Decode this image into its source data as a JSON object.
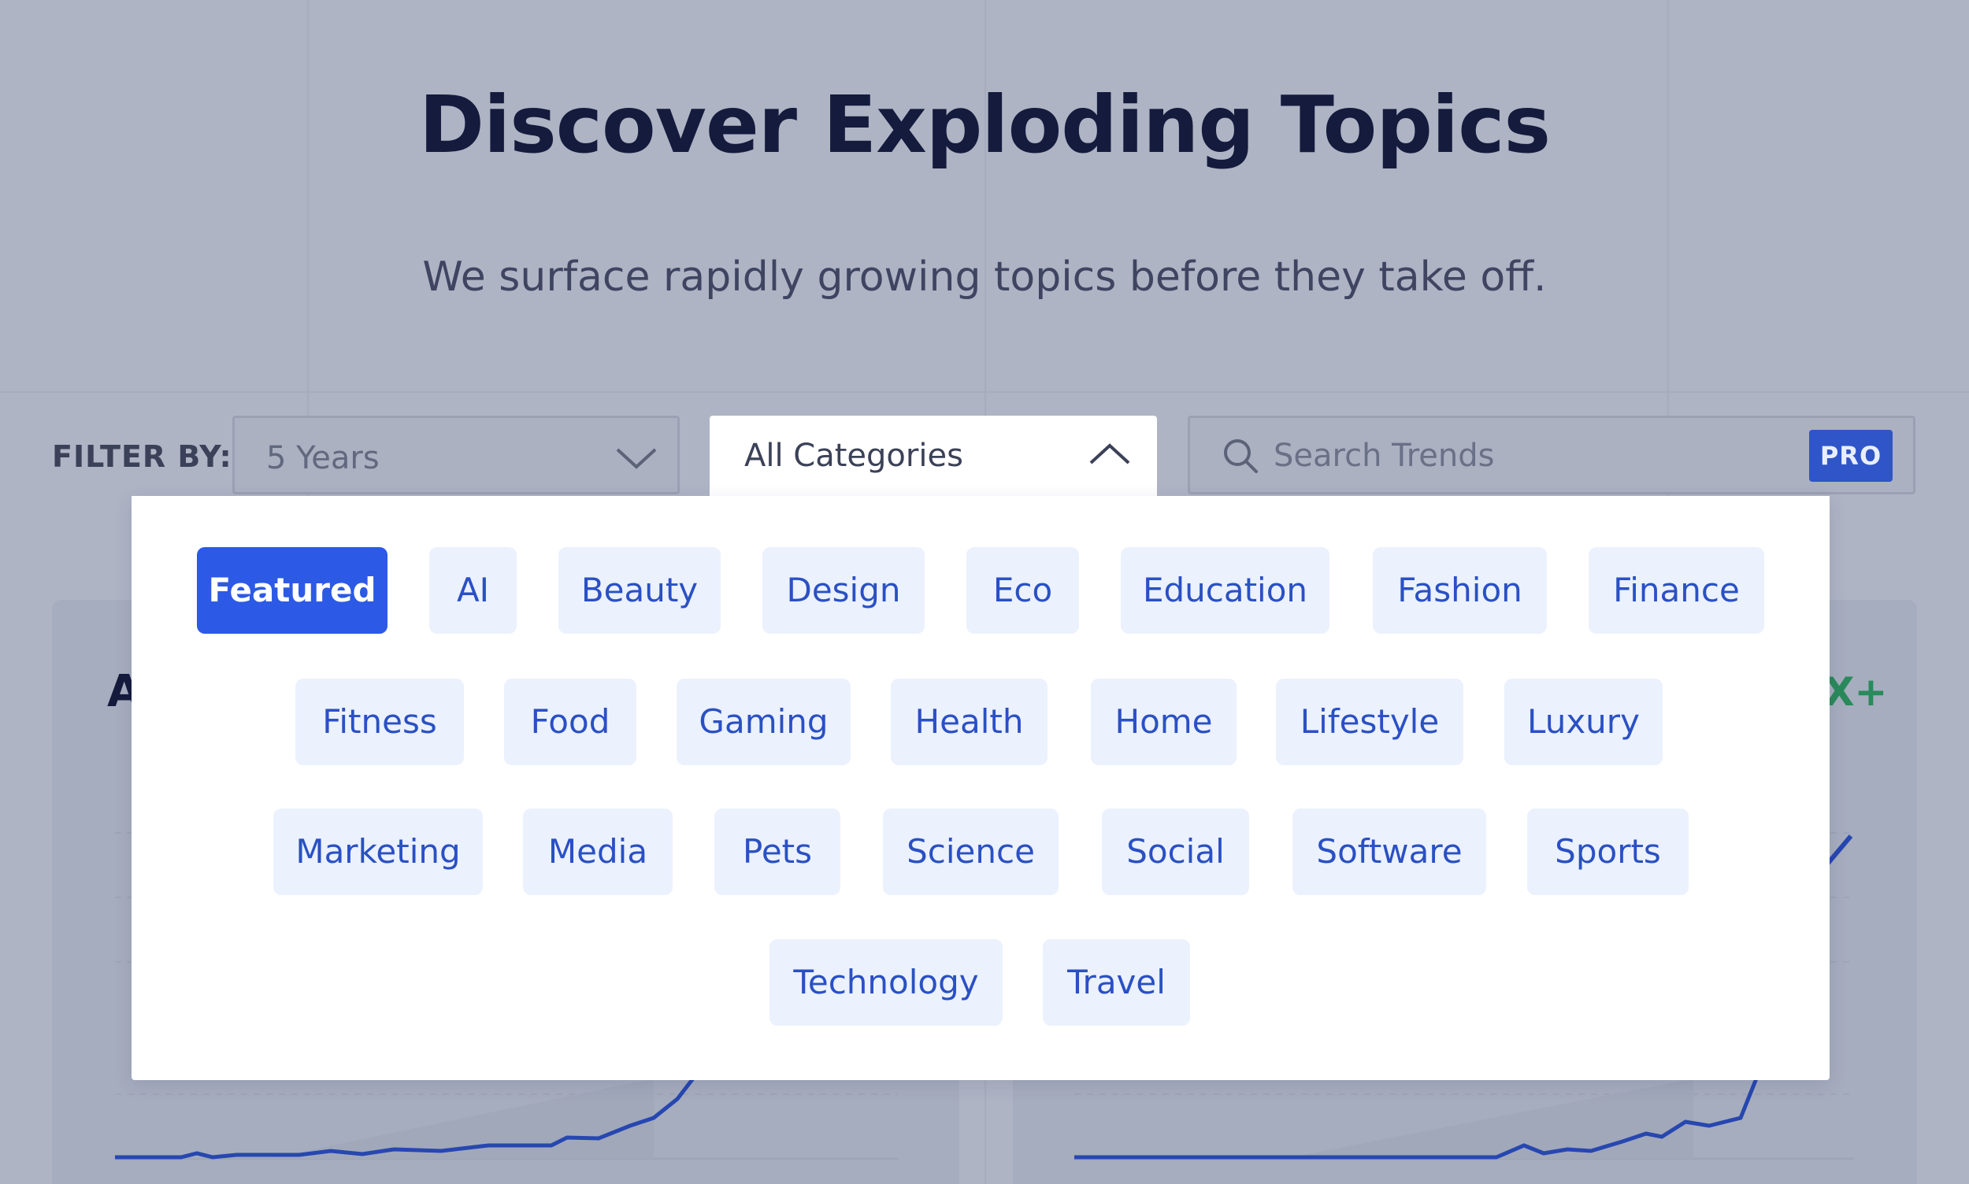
{
  "hero": {
    "title": "Discover Exploding Topics",
    "subtitle": "We surface rapidly growing topics before they take off."
  },
  "filter": {
    "label": "FILTER BY:",
    "timeframe": {
      "selected": "5 Years"
    },
    "category": {
      "selected": "All Categories",
      "expanded": true
    },
    "search": {
      "placeholder": "Search Trends",
      "value": "",
      "badge": "PRO"
    }
  },
  "categories": {
    "active": "Featured",
    "items": [
      "Featured",
      "AI",
      "Beauty",
      "Design",
      "Eco",
      "Education",
      "Fashion",
      "Finance",
      "Fitness",
      "Food",
      "Gaming",
      "Health",
      "Home",
      "Lifestyle",
      "Luxury",
      "Marketing",
      "Media",
      "Pets",
      "Science",
      "Social",
      "Software",
      "Sports",
      "Technology",
      "Travel"
    ]
  },
  "background_cards": {
    "left_title_visible": "A",
    "right_growth_visible": "X+"
  },
  "colors": {
    "accent": "#2c5ae6",
    "chip_bg": "#ebf1fd",
    "chip_text": "#2a50c4",
    "title": "#141b3d",
    "overlay_bg": "#aeb4c4",
    "growth": "#2a8a5b"
  },
  "icons": {
    "timeframe_chevron": "chevron-down-icon",
    "category_chevron": "chevron-up-icon",
    "search": "search-icon"
  }
}
